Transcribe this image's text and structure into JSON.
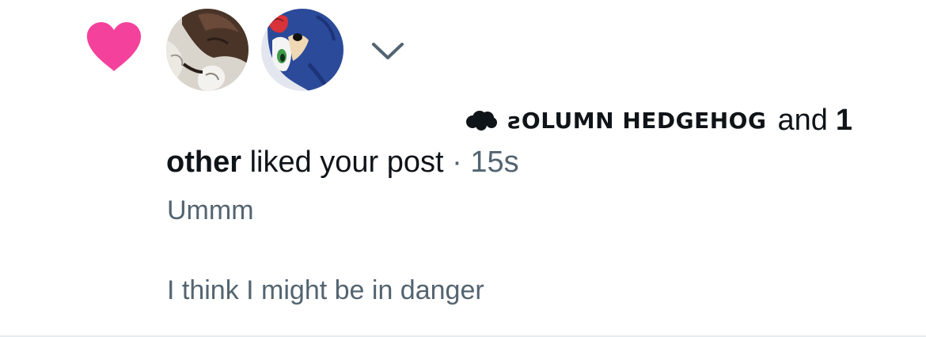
{
  "colors": {
    "heart": "#f4429c",
    "text_primary": "#0f1419",
    "text_secondary": "#536471"
  },
  "notification": {
    "icon": "heart-icon",
    "avatars": [
      "avatar-user-1",
      "avatar-user-2"
    ],
    "expand_icon": "chevron-down-icon",
    "name_emoji_icon": "cloud-icon",
    "display_name": "ꙅOLUMN HEDGEHOG",
    "and_text": "and",
    "other_count": "1",
    "other_label": "other",
    "action_text": "liked your post",
    "separator": "·",
    "timestamp": "15s"
  },
  "post": {
    "line1": "Ummm",
    "line2": "I think I might be in danger"
  }
}
